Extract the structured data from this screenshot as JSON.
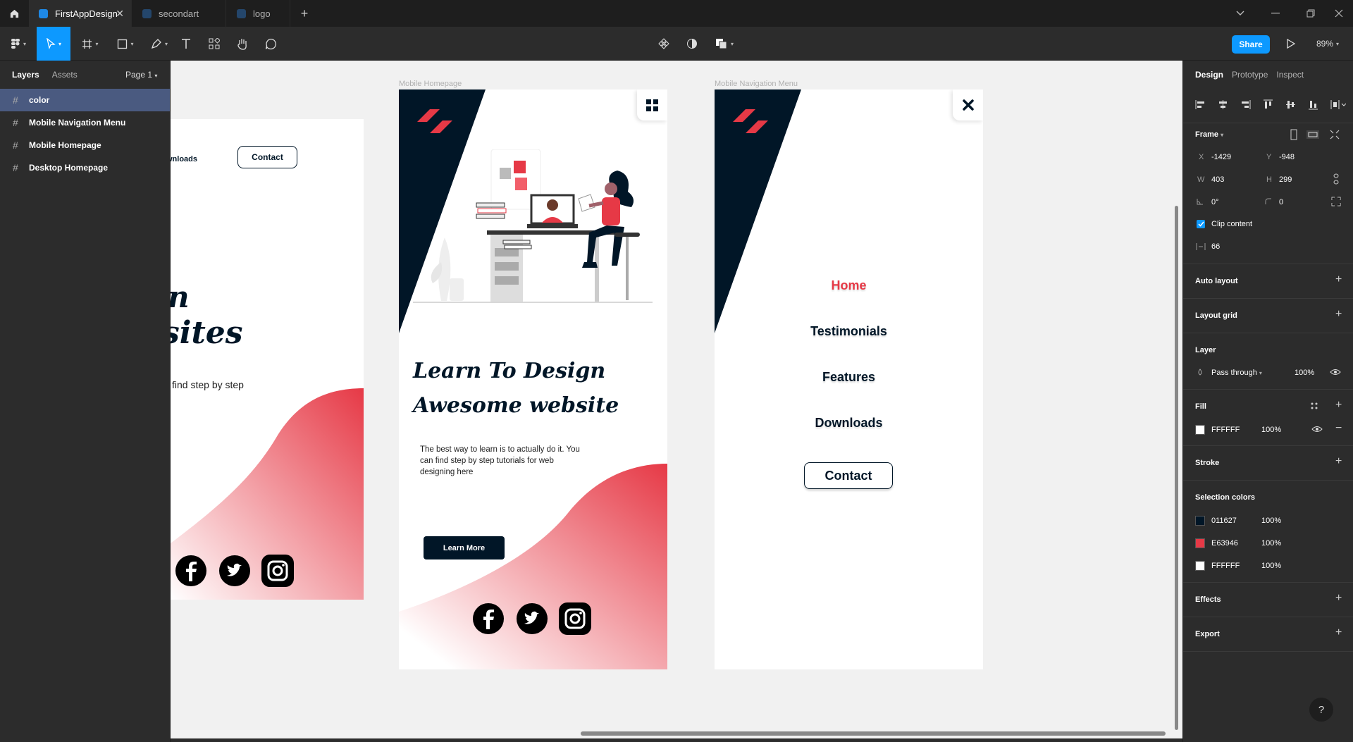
{
  "tabs": [
    {
      "label": "FirstAppDesign",
      "active": true
    },
    {
      "label": "secondart",
      "active": false
    },
    {
      "label": "logo",
      "active": false
    }
  ],
  "toolbar": {
    "share_label": "Share",
    "zoom": "89%"
  },
  "left_panel": {
    "tab_layers": "Layers",
    "tab_assets": "Assets",
    "page": "Page 1",
    "layers": [
      "color",
      "Mobile Navigation Menu",
      "Mobile Homepage",
      "Desktop Homepage"
    ]
  },
  "canvas": {
    "desktop": {
      "nav_partial": "wnloads",
      "contact": "Contact",
      "title_line1": "n",
      "title_line2": "sites",
      "subtitle_partial": "find step by step"
    },
    "mobile_home": {
      "label": "Mobile Homepage",
      "title_line1": "Learn To Design",
      "title_line2": "Awesome website",
      "body": "The best way to learn is to actually do it. You can find step by step tutorials for web designing here",
      "cta": "Learn More"
    },
    "mobile_nav": {
      "label": "Mobile Navigation Menu",
      "items": [
        "Home",
        "Testimonials",
        "Features",
        "Downloads"
      ],
      "contact": "Contact"
    }
  },
  "right_panel": {
    "tabs": [
      "Design",
      "Prototype",
      "Inspect"
    ],
    "frame_label": "Frame",
    "x_label": "X",
    "x": "-1429",
    "y_label": "Y",
    "y": "-948",
    "w_label": "W",
    "w": "403",
    "h_label": "H",
    "h": "299",
    "rotation": "0°",
    "radius": "0",
    "clip_content": "Clip content",
    "spacing": "66",
    "auto_layout": "Auto layout",
    "layout_grid": "Layout grid",
    "layer": "Layer",
    "blend": "Pass through",
    "layer_opacity": "100%",
    "fill": "Fill",
    "fill_hex": "FFFFFF",
    "fill_opacity": "100%",
    "stroke": "Stroke",
    "selection_colors": "Selection colors",
    "colors": [
      {
        "hex": "011627",
        "opacity": "100%",
        "swatch": "#011627"
      },
      {
        "hex": "E63946",
        "opacity": "100%",
        "swatch": "#E63946"
      },
      {
        "hex": "FFFFFF",
        "opacity": "100%",
        "swatch": "#FFFFFF"
      }
    ],
    "effects": "Effects",
    "export": "Export"
  },
  "theme": {
    "dark": "#011627",
    "accent": "#E63946",
    "figma_blue": "#0d99ff"
  }
}
